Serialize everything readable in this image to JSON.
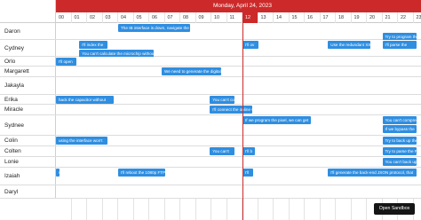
{
  "app": {
    "date_label": "Monday, April 24, 2023",
    "open_sandbox_label": "Open Sandbox"
  },
  "hours": [
    "00",
    "01",
    "02",
    "03",
    "04",
    "05",
    "06",
    "07",
    "08",
    "09",
    "10",
    "11",
    "12",
    "13",
    "14",
    "15",
    "16",
    "17",
    "18",
    "19",
    "20",
    "21",
    "22",
    "23"
  ],
  "current_hour": "12",
  "resources": [
    {
      "name": "Daron",
      "events": [
        {
          "text": "The IB interface is down, navigate the solid state",
          "start": 4.0,
          "end": 8.6
        },
        {
          "text": "Try to program the FTP",
          "start": 21.0,
          "end": 23.2
        }
      ]
    },
    {
      "name": "Cydney",
      "events": [
        {
          "text": "I'll index the",
          "start": 1.5,
          "end": 3.3
        },
        {
          "text": "I'll ov",
          "start": 12.0,
          "end": 13.0
        },
        {
          "text": "Use the redundant XSS",
          "start": 17.5,
          "end": 20.2
        },
        {
          "text": "You can't calculate the microchip without",
          "start": 1.5,
          "end": 6.3
        },
        {
          "text": "I'll parse the",
          "start": 21.0,
          "end": 23.2
        }
      ]
    },
    {
      "name": "Orlo",
      "events": [
        {
          "text": "I'll open",
          "start": 0.0,
          "end": 1.3
        }
      ]
    },
    {
      "name": "Margarett",
      "events": [
        {
          "text": "We need to generate the digital JSON",
          "start": 6.8,
          "end": 10.6
        }
      ]
    },
    {
      "name": "Jakayla",
      "events": []
    },
    {
      "name": "Erika",
      "events": [
        {
          "text": "hack the capacitor without",
          "start": 0.0,
          "end": 3.7
        },
        {
          "text": "You can't copy",
          "start": 9.9,
          "end": 11.5
        }
      ]
    },
    {
      "name": "Miracle",
      "events": [
        {
          "text": "I'll connect the online GB",
          "start": 9.9,
          "end": 12.6
        }
      ]
    },
    {
      "name": "Sydnee",
      "events": [
        {
          "text": "If we program the pixel, we can get",
          "start": 12.0,
          "end": 16.4
        },
        {
          "text": "You can't compress the",
          "start": 21.0,
          "end": 23.2
        },
        {
          "text": "If we bypass the",
          "start": 21.0,
          "end": 23.2
        }
      ]
    },
    {
      "name": "Colin",
      "events": [
        {
          "text": "using the interface won't",
          "start": 0.0,
          "end": 3.3
        },
        {
          "text": "Try to back up the XML",
          "start": 21.0,
          "end": 23.2
        }
      ]
    },
    {
      "name": "Colten",
      "events": [
        {
          "text": "You can't",
          "start": 9.9,
          "end": 11.5
        },
        {
          "text": "I'll b",
          "start": 12.0,
          "end": 12.8
        },
        {
          "text": "Try to parse the PCI protocol",
          "start": 21.0,
          "end": 23.2
        }
      ]
    },
    {
      "name": "Lonie",
      "events": [
        {
          "text": "You can't back up the",
          "start": 21.0,
          "end": 23.2
        }
      ]
    },
    {
      "name": "Izaiah",
      "events": [
        {
          "text": "s",
          "start": 0.0,
          "end": 0.2
        },
        {
          "text": "I'll reboot the 1080p FTP",
          "start": 4.0,
          "end": 7.0
        },
        {
          "text": "I'll",
          "start": 12.0,
          "end": 12.7
        },
        {
          "text": "I'll generate the back-end JSON protocol, that",
          "start": 17.5,
          "end": 23.2
        }
      ]
    },
    {
      "name": "Daryl",
      "events": []
    }
  ]
}
